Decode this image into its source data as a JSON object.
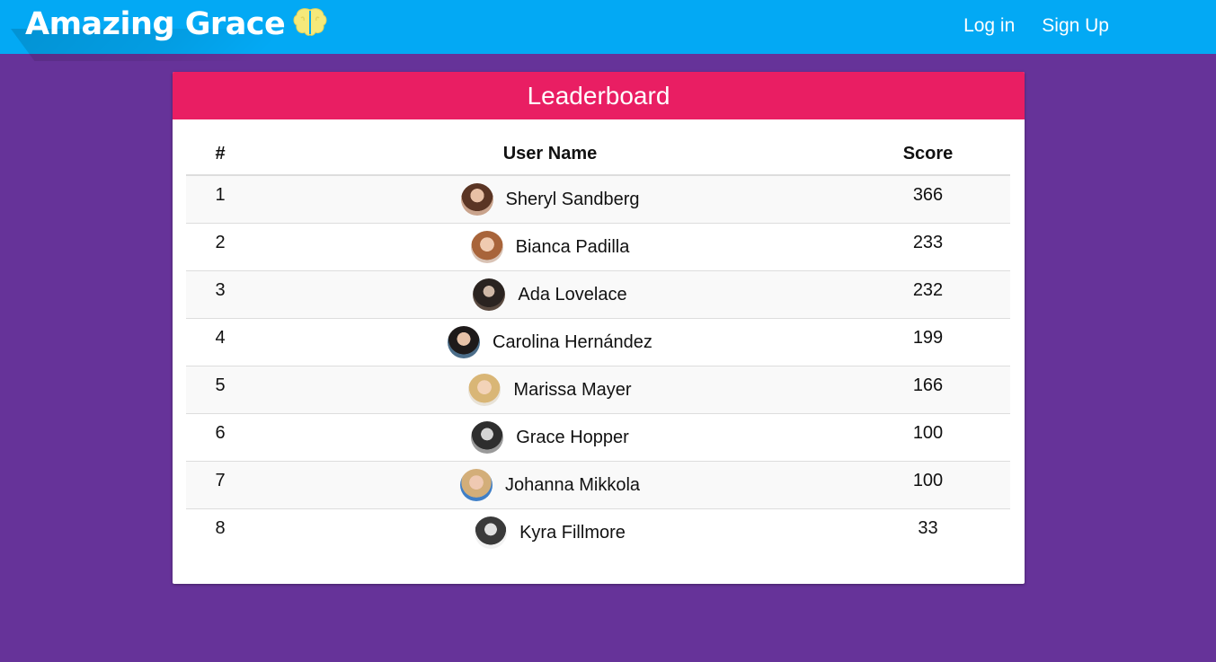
{
  "nav": {
    "brand": "Amazing Grace",
    "brand_icon": "brain-icon",
    "brand_icon_color": "#f5e97a",
    "login": "Log in",
    "signup": "Sign Up",
    "bar_color": "#03a9f4"
  },
  "background_color": "#663399",
  "leaderboard": {
    "title": "Leaderboard",
    "header_color": "#e91e63",
    "columns": [
      "#",
      "User Name",
      "Score"
    ],
    "rows": [
      {
        "rank": "1",
        "name": "Sheryl Sandberg",
        "score": "366",
        "avatar": "avatar-photo"
      },
      {
        "rank": "2",
        "name": "Bianca Padilla",
        "score": "233",
        "avatar": "avatar-photo"
      },
      {
        "rank": "3",
        "name": "Ada Lovelace",
        "score": "232",
        "avatar": "avatar-photo"
      },
      {
        "rank": "4",
        "name": "Carolina Hernández",
        "score": "199",
        "avatar": "avatar-photo"
      },
      {
        "rank": "5",
        "name": "Marissa Mayer",
        "score": "166",
        "avatar": "avatar-photo"
      },
      {
        "rank": "6",
        "name": "Grace Hopper",
        "score": "100",
        "avatar": "avatar-photo"
      },
      {
        "rank": "7",
        "name": "Johanna Mikkola",
        "score": "100",
        "avatar": "avatar-photo"
      },
      {
        "rank": "8",
        "name": "Kyra Fillmore",
        "score": "33",
        "avatar": "avatar-photo"
      }
    ]
  }
}
